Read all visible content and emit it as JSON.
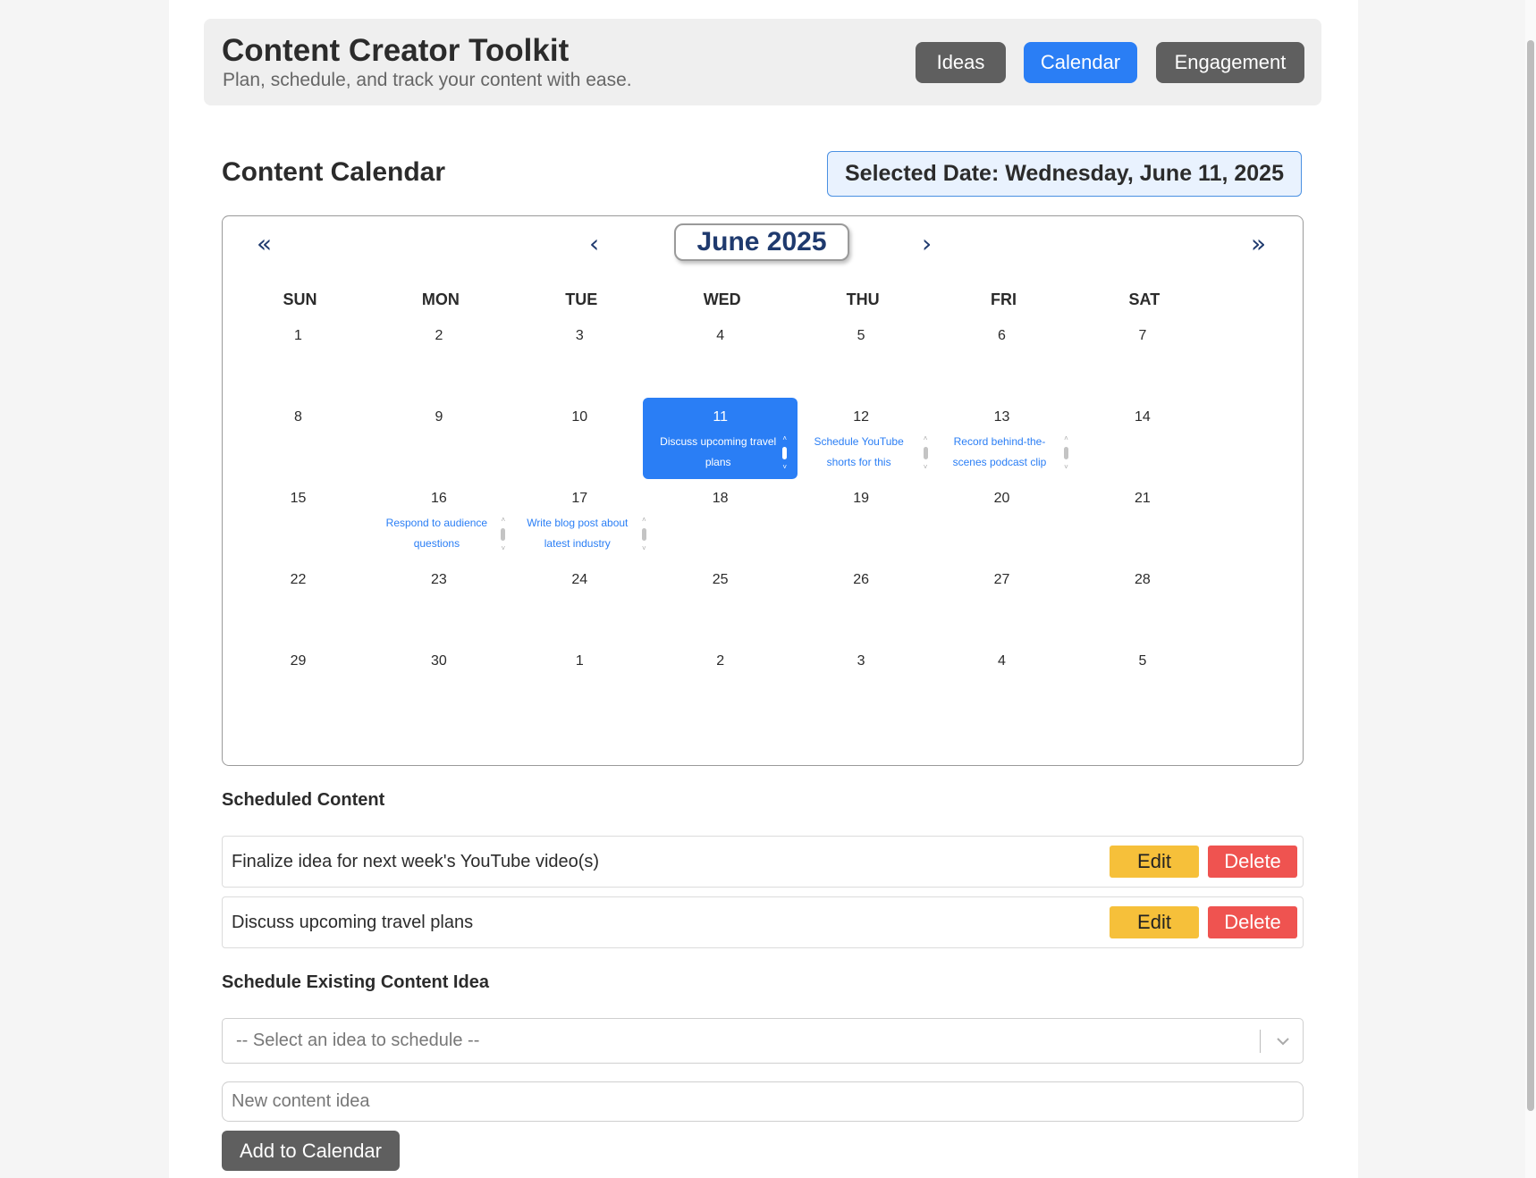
{
  "header": {
    "title": "Content Creator Toolkit",
    "subtitle": "Plan, schedule, and track your content with ease.",
    "nav": [
      {
        "label": "Ideas",
        "active": false
      },
      {
        "label": "Calendar",
        "active": true
      },
      {
        "label": "Engagement",
        "active": false
      }
    ]
  },
  "calendar_section": {
    "title": "Content Calendar",
    "selected_date_text": "Selected Date: Wednesday, June 11, 2025"
  },
  "calendar": {
    "month_label": "June 2025",
    "nav": {
      "prev_year": "«",
      "prev_month": "‹",
      "next_month": "›",
      "next_year": "»"
    },
    "weekdays": [
      "SUN",
      "MON",
      "TUE",
      "WED",
      "THU",
      "FRI",
      "SAT"
    ],
    "selected_day": "11",
    "weeks": [
      [
        {
          "day": "1"
        },
        {
          "day": "2"
        },
        {
          "day": "3"
        },
        {
          "day": "4"
        },
        {
          "day": "5"
        },
        {
          "day": "6"
        },
        {
          "day": "7"
        }
      ],
      [
        {
          "day": "8"
        },
        {
          "day": "9"
        },
        {
          "day": "10"
        },
        {
          "day": "11",
          "event": "Discuss upcoming travel plans",
          "selected": true
        },
        {
          "day": "12",
          "event": "Schedule YouTube shorts for this"
        },
        {
          "day": "13",
          "event": "Record behind-the-scenes podcast clip"
        },
        {
          "day": "14"
        }
      ],
      [
        {
          "day": "15"
        },
        {
          "day": "16",
          "event": "Respond to audience questions"
        },
        {
          "day": "17",
          "event": "Write blog post about latest industry"
        },
        {
          "day": "18"
        },
        {
          "day": "19"
        },
        {
          "day": "20"
        },
        {
          "day": "21"
        }
      ],
      [
        {
          "day": "22"
        },
        {
          "day": "23"
        },
        {
          "day": "24"
        },
        {
          "day": "25"
        },
        {
          "day": "26"
        },
        {
          "day": "27"
        },
        {
          "day": "28"
        }
      ],
      [
        {
          "day": "29"
        },
        {
          "day": "30"
        },
        {
          "day": "1"
        },
        {
          "day": "2"
        },
        {
          "day": "3"
        },
        {
          "day": "4"
        },
        {
          "day": "5"
        }
      ]
    ]
  },
  "scheduled": {
    "title": "Scheduled Content",
    "items": [
      {
        "text": "Finalize idea for next week's YouTube video(s)",
        "edit_label": "Edit",
        "delete_label": "Delete"
      },
      {
        "text": "Discuss upcoming travel plans",
        "edit_label": "Edit",
        "delete_label": "Delete"
      }
    ]
  },
  "schedule_existing": {
    "title": "Schedule Existing Content Idea",
    "select_placeholder": "-- Select an idea to schedule --",
    "input_placeholder": "New content idea",
    "add_button_label": "Add to Calendar"
  },
  "colors": {
    "accent": "#2a7ef5",
    "nav_inactive": "#5f5f5f",
    "edit": "#f6c03a",
    "delete": "#ef5350",
    "month_text": "#1f3a6e"
  },
  "icons": {
    "select_chevron": "chevron-down-icon"
  }
}
